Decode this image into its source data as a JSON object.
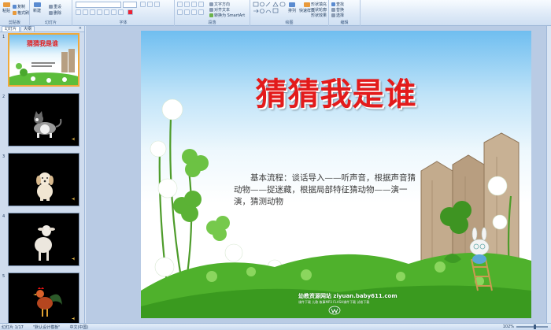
{
  "ribbon": {
    "groups": [
      {
        "label": "剪贴板",
        "buttons": [
          "粘贴",
          "复制",
          "格式刷"
        ]
      },
      {
        "label": "幻灯片",
        "buttons": [
          "新建",
          "重设",
          "删除"
        ]
      },
      {
        "label": "字体",
        "buttons": []
      },
      {
        "label": "段落",
        "buttons": [
          "文字方向",
          "对齐文本",
          "转换为 SmartArt"
        ]
      },
      {
        "label": "绘图",
        "buttons": [
          "排列",
          "快速样式"
        ]
      },
      {
        "label": "编辑",
        "buttons": [
          "查找",
          "替换",
          "选择"
        ]
      }
    ],
    "drawing_extra": [
      "形状填充",
      "形状轮廓",
      "形状效果"
    ]
  },
  "left_pane": {
    "tab_slides": "幻灯片",
    "tab_outline": "大纲",
    "close": "×",
    "thumbnails": [
      {
        "num": "1",
        "title": "猜猜我是谁",
        "kind": "title"
      },
      {
        "num": "2",
        "animal": "cat-icon"
      },
      {
        "num": "3",
        "animal": "puppy-icon"
      },
      {
        "num": "4",
        "animal": "lamb-icon"
      },
      {
        "num": "5",
        "animal": "rooster-icon"
      }
    ]
  },
  "slide": {
    "title": "猜猜我是谁",
    "body": "基本流程：谈话导入——听声音，根据声音猜动物——捉迷藏，根据局部特征猜动物——演一演，猜测动物",
    "brand": "幼教资源网站  ziyuan.baby611.com",
    "brand_sub": "课件下载  儿歌  故事MP3  FLASH课件下载  试卷下载"
  },
  "status": {
    "slide_count": "幻灯片 1/17",
    "theme": "\"默认设计模板\"",
    "language": "中文(中国)",
    "zoom": "102%"
  },
  "colors": {
    "title_red": "#e31b1b",
    "ribbon_bg": "#dde9f7",
    "selection": "#f0a93a"
  }
}
